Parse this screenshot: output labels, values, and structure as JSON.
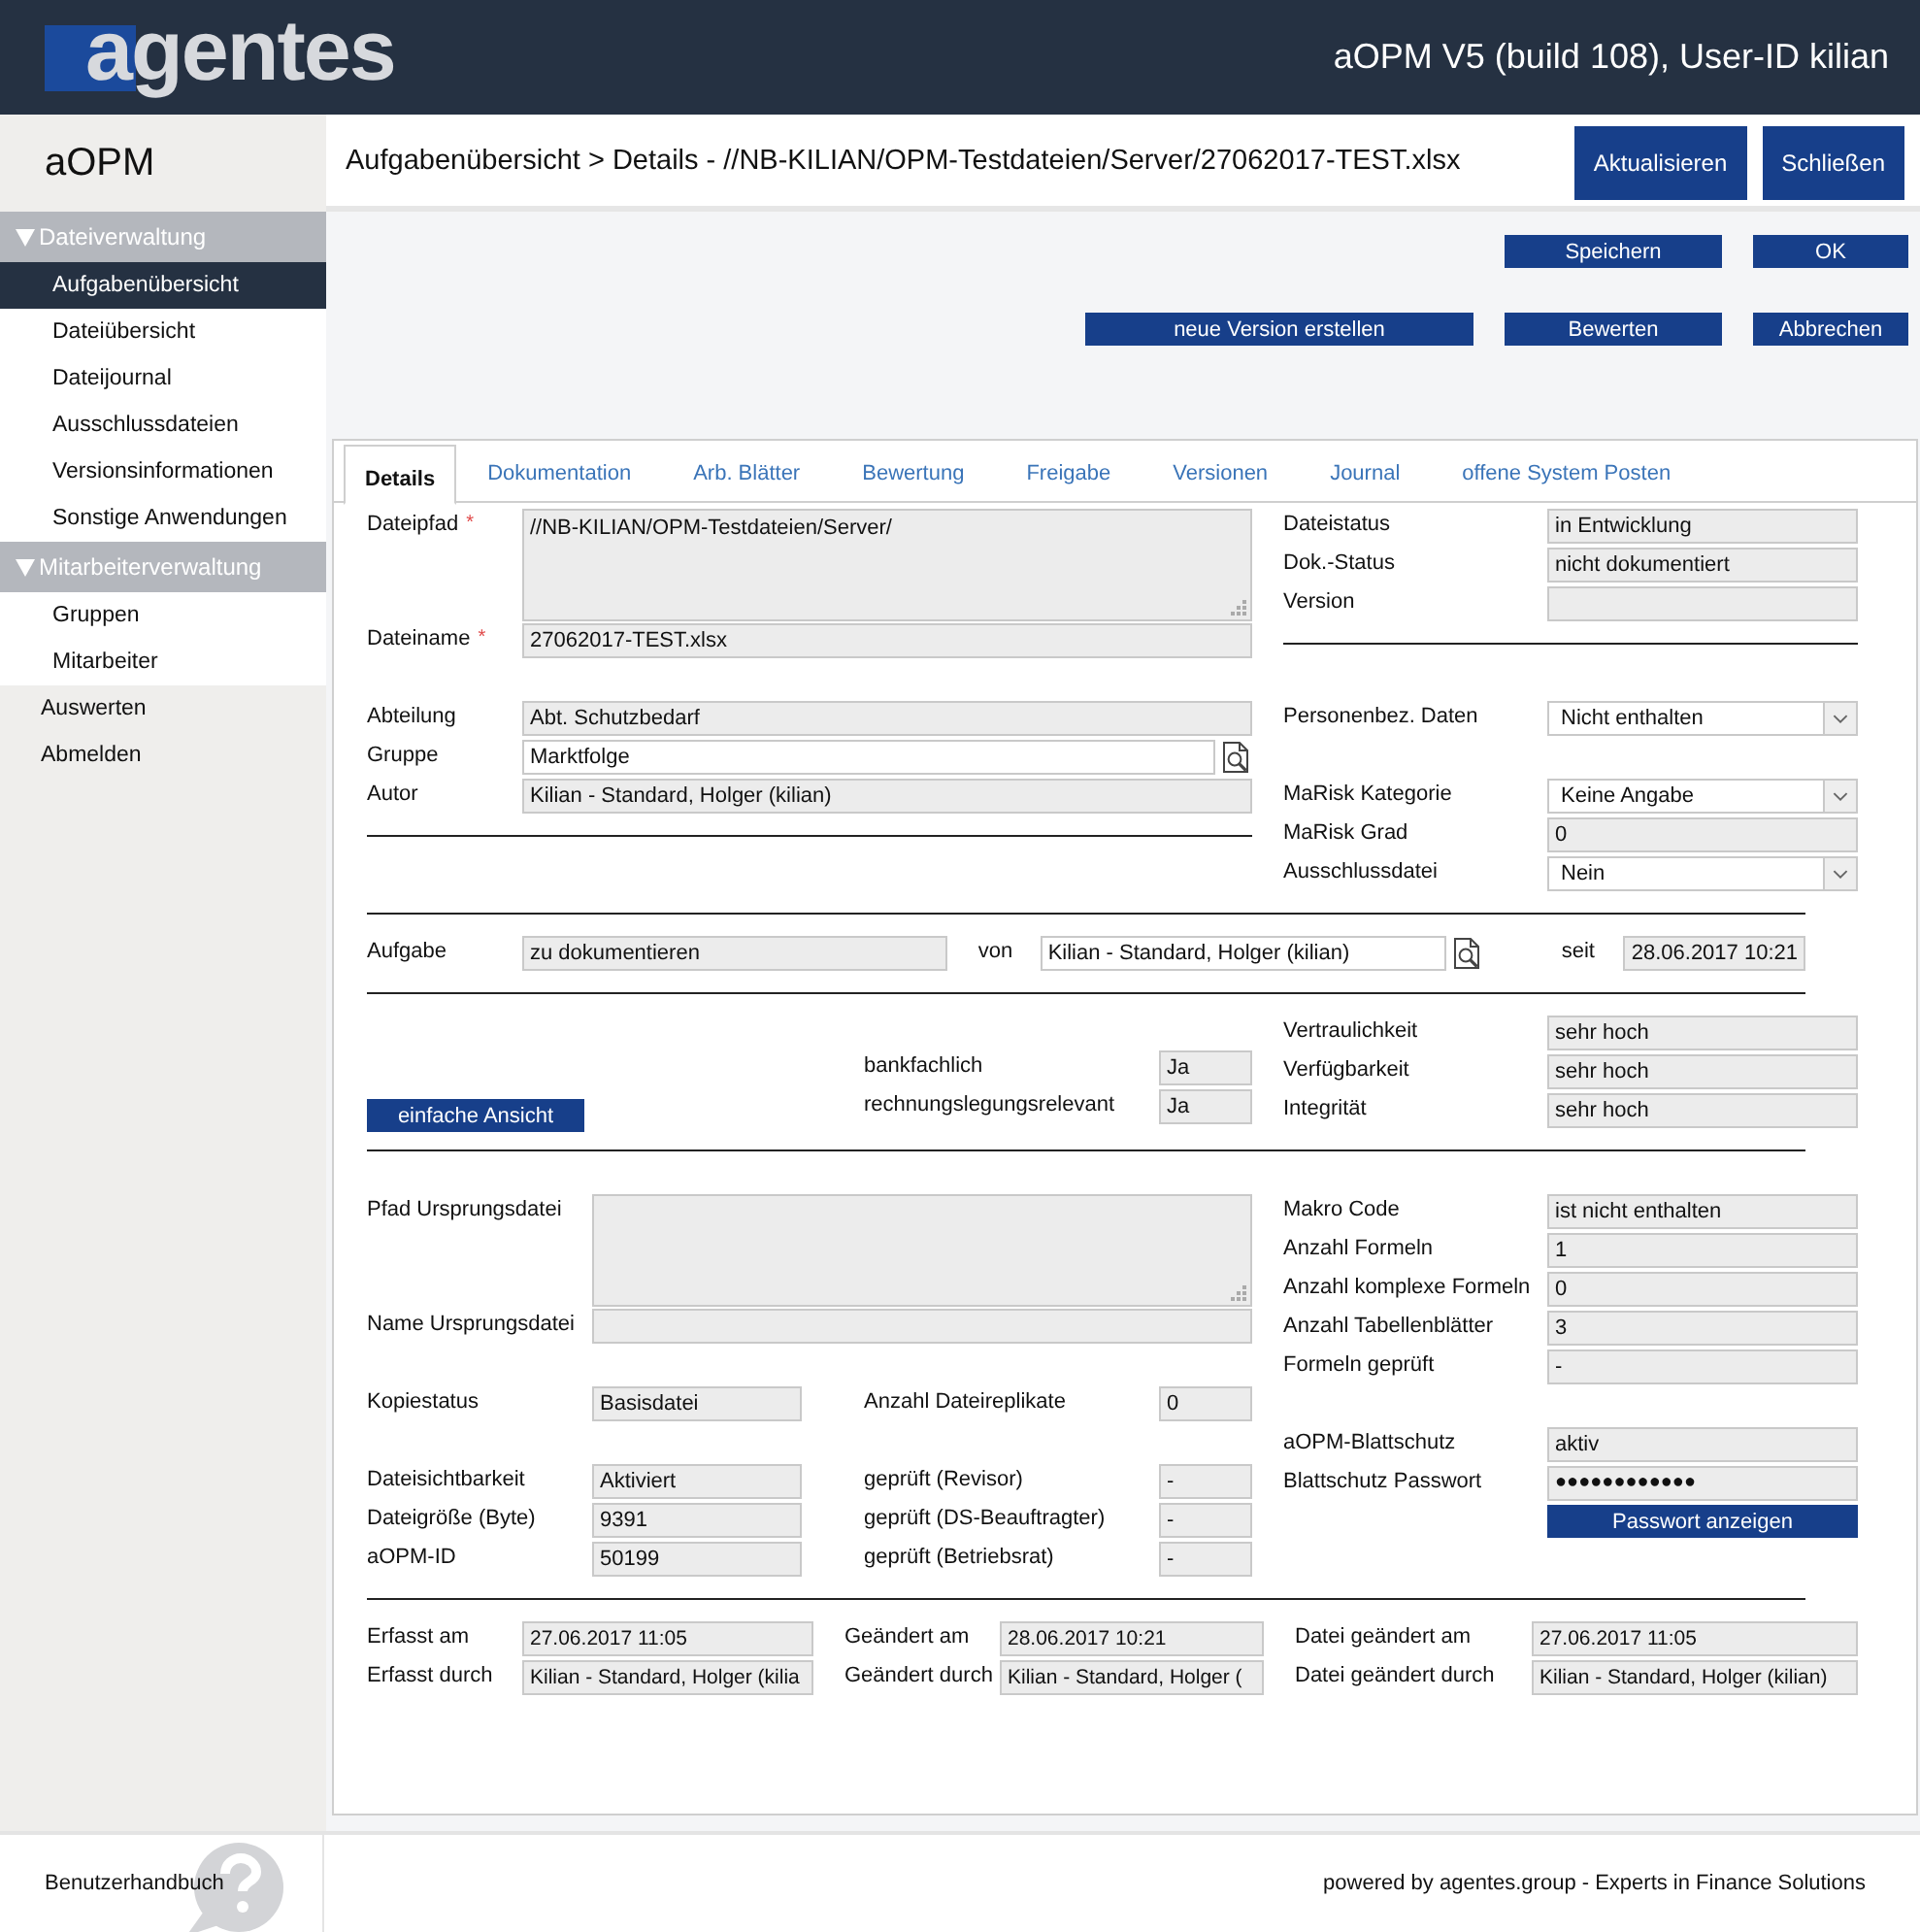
{
  "header": {
    "logo": "agentes",
    "title": "aOPM V5 (build 108), User-ID kilian"
  },
  "app_name": "aOPM",
  "breadcrumb": "Aufgabenübersicht > Details - //NB-KILIAN/OPM-Testdateien/Server/27062017-TEST.xlsx",
  "top_buttons": [
    "Aktualisieren",
    "Schließen"
  ],
  "sidebar": [
    {
      "kind": "group",
      "label": "Dateiverwaltung",
      "expanded": true,
      "children": [
        {
          "label": "Aufgabenübersicht",
          "selected": true
        },
        {
          "label": "Dateiübersicht",
          "selected": false
        },
        {
          "label": "Dateijournal",
          "selected": false
        },
        {
          "label": "Ausschlussdateien",
          "selected": false
        },
        {
          "label": "Versionsinformationen",
          "selected": false
        },
        {
          "label": "Sonstige Anwendungen",
          "selected": false
        }
      ]
    },
    {
      "kind": "group",
      "label": "Mitarbeiterverwaltung",
      "expanded": true,
      "children": [
        {
          "label": "Gruppen",
          "selected": false
        },
        {
          "label": "Mitarbeiter",
          "selected": false
        }
      ]
    },
    {
      "kind": "link",
      "label": "Auswerten",
      "selected": false
    },
    {
      "kind": "link",
      "label": "Abmelden",
      "selected": false
    }
  ],
  "action_rows": [
    [
      "Speichern",
      "OK"
    ],
    [
      "neue Version erstellen",
      "Bewerten",
      "Abbrechen"
    ]
  ],
  "tabs": [
    {
      "label": "Details",
      "selected": true
    },
    {
      "label": "Dokumentation",
      "selected": false
    },
    {
      "label": "Arb. Blätter",
      "selected": false
    },
    {
      "label": "Bewertung",
      "selected": false
    },
    {
      "label": "Freigabe",
      "selected": false
    },
    {
      "label": "Versionen",
      "selected": false
    },
    {
      "label": "Journal",
      "selected": false
    },
    {
      "label": "offene System Posten",
      "selected": false
    }
  ],
  "sections": [
    {
      "kind": "split",
      "left": [
        [
          {
            "kind": "textarea",
            "label": "Dateipfad",
            "required_mark": "*",
            "value": "//NB-KILIAN/OPM-Testdateien/Server/"
          },
          {
            "kind": "readonly",
            "label": "Dateiname",
            "required_mark": "*",
            "value": "27062017-TEST.xlsx"
          }
        ]
      ],
      "right": [
        [
          {
            "kind": "readonly",
            "label": "Dateistatus",
            "value": "in Entwicklung"
          },
          {
            "kind": "readonly",
            "label": "Dok.-Status",
            "value": "nicht dokumentiert"
          },
          {
            "kind": "readonly",
            "label": "Version"
          },
          {
            "kind": "rule"
          }
        ]
      ]
    },
    {
      "kind": "split",
      "left": [
        [
          {
            "kind": "readonly",
            "label": "Abteilung",
            "value": "Abt. Schutzbedarf"
          },
          {
            "kind": "lookup",
            "label": "Gruppe",
            "value": "Marktfolge"
          },
          {
            "kind": "readonly",
            "label": "Autor",
            "value": "Kilian - Standard, Holger (kilian)"
          },
          {
            "kind": "rule"
          }
        ]
      ],
      "right": [
        [
          {
            "kind": "select",
            "label": "Personenbez. Daten",
            "value": "Nicht enthalten"
          }
        ],
        [
          {
            "kind": "select",
            "label": "MaRisk Kategorie",
            "value": "Keine Angabe"
          },
          {
            "kind": "readonly",
            "label": "MaRisk Grad",
            "value": "0"
          },
          {
            "kind": "select",
            "label": "Ausschlussdatei",
            "value": "Nein"
          }
        ]
      ]
    },
    {
      "kind": "rule"
    },
    {
      "kind": "task",
      "fields": [
        {
          "kind": "readonly",
          "label": "Aufgabe",
          "value": "zu dokumentieren"
        },
        {
          "kind": "lookup",
          "label": "von",
          "value": "Kilian - Standard, Holger (kilian)"
        },
        {
          "kind": "readonly",
          "label": "seit",
          "value": "28.06.2017 10:21"
        }
      ]
    },
    {
      "kind": "rule"
    },
    {
      "kind": "split",
      "left": [
        [
          {
            "kind": "aside",
            "button": "einfache Ansicht",
            "fields": [
              {
                "kind": "readonly",
                "label": "bankfachlich",
                "value": "Ja"
              },
              {
                "kind": "readonly",
                "label": "rechnungslegungsrelevant",
                "value": "Ja"
              }
            ]
          }
        ]
      ],
      "right": [
        [
          {
            "kind": "readonly",
            "label": "Vertraulichkeit",
            "value": "sehr hoch"
          },
          {
            "kind": "readonly",
            "label": "Verfügbarkeit",
            "value": "sehr hoch"
          },
          {
            "kind": "readonly",
            "label": "Integrität",
            "value": "sehr hoch"
          }
        ]
      ]
    },
    {
      "kind": "rule"
    },
    {
      "kind": "split-wide",
      "left": [
        [
          {
            "kind": "textarea",
            "label": "Pfad Ursprungsdatei"
          },
          {
            "kind": "readonly",
            "label": "Name Ursprungsdatei"
          }
        ],
        [
          {
            "kind": "pair",
            "fields": [
              {
                "kind": "readonly",
                "label": "Kopiestatus",
                "value": "Basisdatei"
              },
              {
                "kind": "readonly",
                "label": "Anzahl Dateireplikate",
                "value": "0"
              }
            ]
          }
        ],
        [
          {
            "kind": "pair",
            "fields": [
              {
                "kind": "readonly",
                "label": "Dateisichtbarkeit",
                "value": "Aktiviert"
              },
              {
                "kind": "readonly",
                "label": "geprüft (Revisor)",
                "value": "-"
              }
            ]
          },
          {
            "kind": "pair",
            "fields": [
              {
                "kind": "readonly",
                "label": "Dateigröße (Byte)",
                "value": "9391"
              },
              {
                "kind": "readonly",
                "label": "geprüft (DS-Beauftragter)",
                "value": "-"
              }
            ]
          },
          {
            "kind": "pair",
            "fields": [
              {
                "kind": "readonly",
                "label": "aOPM-ID",
                "value": "50199"
              },
              {
                "kind": "readonly",
                "label": "geprüft (Betriebsrat)",
                "value": "-"
              }
            ]
          }
        ]
      ],
      "right": [
        [
          {
            "kind": "readonly",
            "label": "Makro Code",
            "value": "ist nicht enthalten"
          },
          {
            "kind": "readonly",
            "label": "Anzahl Formeln",
            "value": "1"
          },
          {
            "kind": "readonly",
            "label": "Anzahl komplexe Formeln",
            "value": "0"
          },
          {
            "kind": "readonly",
            "label": "Anzahl Tabellenblätter",
            "value": "3"
          },
          {
            "kind": "readonly",
            "label": "Formeln geprüft",
            "value": "-"
          }
        ],
        [
          {
            "kind": "readonly",
            "label": "aOPM-Blattschutz",
            "value": "aktiv"
          },
          {
            "kind": "password",
            "label": "Blattschutz Passwort",
            "value": "●●●●●●●●●●●●"
          },
          {
            "kind": "button",
            "label": "Passwort anzeigen"
          }
        ]
      ]
    },
    {
      "kind": "rule"
    },
    {
      "kind": "triple",
      "columns": [
        [
          {
            "kind": "readonly",
            "label": "Erfasst am",
            "value": "27.06.2017 11:05"
          },
          {
            "kind": "readonly",
            "label": "Erfasst durch",
            "value": "Kilian - Standard, Holger (kilia"
          }
        ],
        [
          {
            "kind": "readonly",
            "label": "Geändert am",
            "value": "28.06.2017 10:21"
          },
          {
            "kind": "readonly",
            "label": "Geändert durch",
            "value": "Kilian - Standard, Holger ("
          }
        ],
        [
          {
            "kind": "readonly",
            "label": "Datei geändert am",
            "value": "27.06.2017 11:05"
          },
          {
            "kind": "readonly",
            "label": "Datei geändert durch",
            "value": "Kilian - Standard, Holger (kilian)"
          }
        ]
      ]
    }
  ],
  "footer": {
    "help_link": "Benutzerhandbuch",
    "credit": "powered by agentes.group - Experts in Finance Solutions"
  }
}
